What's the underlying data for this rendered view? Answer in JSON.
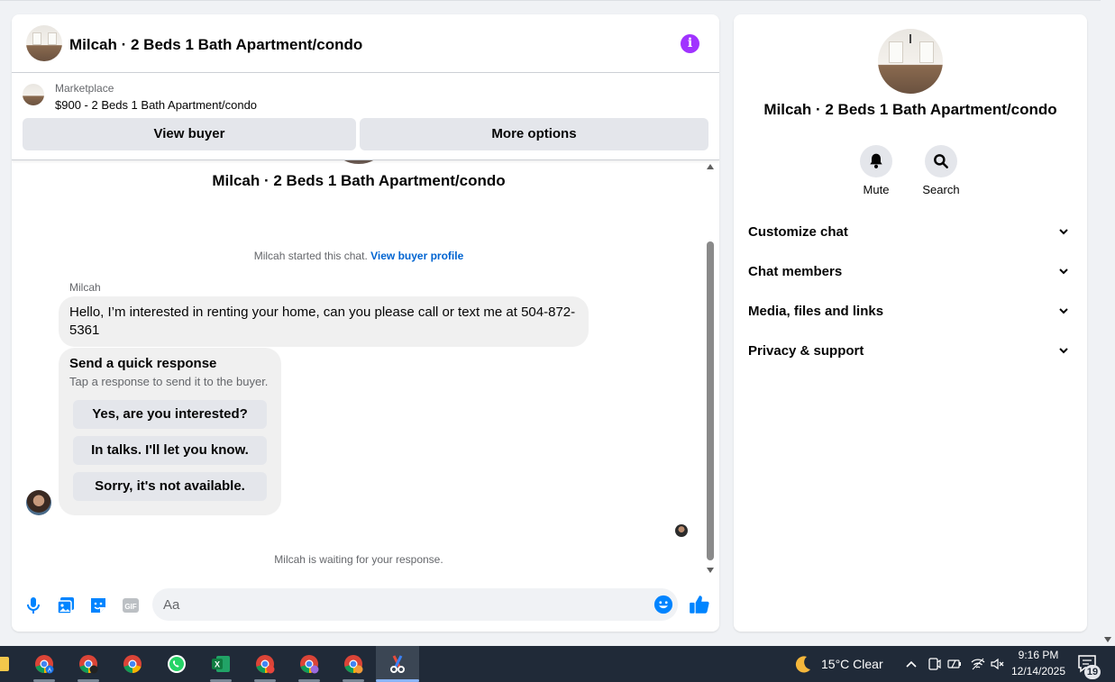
{
  "header": {
    "title": "Milcah · 2 Beds 1 Bath Apartment/condo"
  },
  "listing": {
    "label": "Marketplace",
    "price_line": "$900 - 2 Beds 1 Bath Apartment/condo",
    "view_buyer": "View buyer",
    "more_options": "More options"
  },
  "thread": {
    "title": "Milcah · 2 Beds 1 Bath Apartment/condo",
    "started_text": "Milcah started this chat.",
    "view_profile": "View buyer profile",
    "sender": "Milcah",
    "message": "Hello, I’m interested in renting your home, can you please call or text me at 504-872-5361",
    "quick": {
      "title": "Send a quick response",
      "subtitle": "Tap a response to send it to the buyer.",
      "options": [
        "Yes, are you interested?",
        "In talks. I'll let you know.",
        "Sorry, it's not available."
      ]
    },
    "waiting": "Milcah is waiting for your response."
  },
  "composer": {
    "placeholder": "Aa"
  },
  "info_panel": {
    "title": "Milcah · 2 Beds 1 Bath Apartment/condo",
    "actions": [
      "Mute",
      "Search"
    ],
    "sections": [
      "Customize chat",
      "Chat members",
      "Media, files and links",
      "Privacy & support"
    ]
  },
  "taskbar": {
    "weather": "15°C  Clear",
    "time": "9:16 PM",
    "date": "12/14/2025",
    "notifications": "19"
  },
  "colors": {
    "accent": "#0084ff",
    "info": "#a033ff",
    "link": "#0064d1"
  }
}
